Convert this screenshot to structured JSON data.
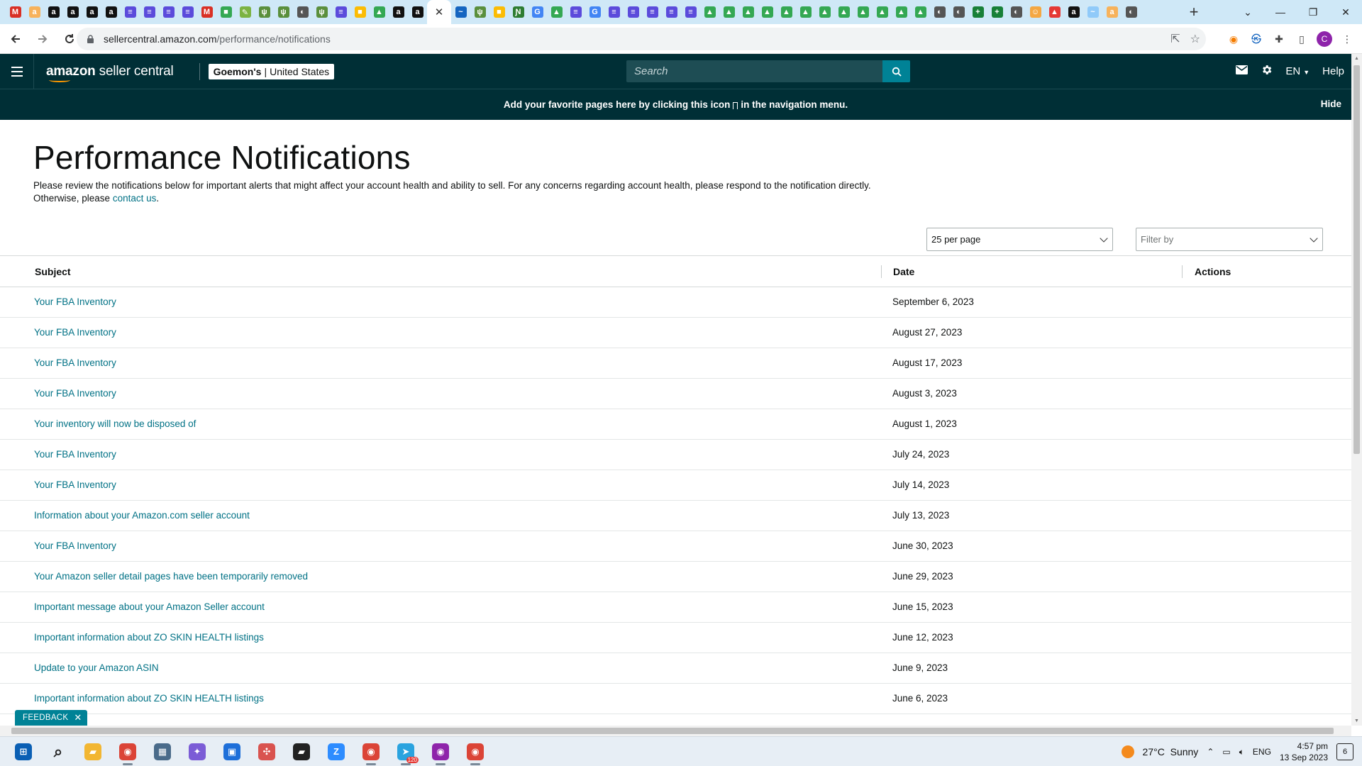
{
  "browser": {
    "tab_favicons": [
      {
        "letter": "M",
        "color": "#d93025"
      },
      {
        "letter": "a",
        "color": "#f7b25b"
      },
      {
        "letter": "a",
        "color": "#111111"
      },
      {
        "letter": "a",
        "color": "#111111"
      },
      {
        "letter": "a",
        "color": "#111111"
      },
      {
        "letter": "a",
        "color": "#111111"
      },
      {
        "letter": "≡",
        "color": "#5b4bdb"
      },
      {
        "letter": "≡",
        "color": "#5b4bdb"
      },
      {
        "letter": "≡",
        "color": "#5b4bdb"
      },
      {
        "letter": "≡",
        "color": "#5b4bdb"
      },
      {
        "letter": "M",
        "color": "#d93025"
      },
      {
        "letter": "■",
        "color": "#34a853"
      },
      {
        "letter": "✎",
        "color": "#7cb342"
      },
      {
        "letter": "ψ",
        "color": "#5a8f3c"
      },
      {
        "letter": "ψ",
        "color": "#5a8f3c"
      },
      {
        "letter": "◐",
        "color": "#555555"
      },
      {
        "letter": "ψ",
        "color": "#5a8f3c"
      },
      {
        "letter": "≡",
        "color": "#5b4bdb"
      },
      {
        "letter": "■",
        "color": "#fbbc04"
      },
      {
        "letter": "▲",
        "color": "#34a853"
      },
      {
        "letter": "a",
        "color": "#111111"
      },
      {
        "letter": "a",
        "color": "#111111"
      },
      {
        "letter": "✕",
        "color": "#ffffff"
      },
      {
        "letter": "~",
        "color": "#1565c0"
      },
      {
        "letter": "ψ",
        "color": "#5a8f3c"
      },
      {
        "letter": "■",
        "color": "#fbbc04"
      },
      {
        "letter": "Ɲ",
        "color": "#2e7d32"
      },
      {
        "letter": "G",
        "color": "#4285f4"
      },
      {
        "letter": "▲",
        "color": "#34a853"
      },
      {
        "letter": "≡",
        "color": "#5b4bdb"
      },
      {
        "letter": "G",
        "color": "#4285f4"
      },
      {
        "letter": "≡",
        "color": "#5b4bdb"
      },
      {
        "letter": "≡",
        "color": "#5b4bdb"
      },
      {
        "letter": "≡",
        "color": "#5b4bdb"
      },
      {
        "letter": "≡",
        "color": "#5b4bdb"
      },
      {
        "letter": "≡",
        "color": "#5b4bdb"
      },
      {
        "letter": "▲",
        "color": "#34a853"
      },
      {
        "letter": "▲",
        "color": "#34a853"
      },
      {
        "letter": "▲",
        "color": "#34a853"
      },
      {
        "letter": "▲",
        "color": "#34a853"
      },
      {
        "letter": "▲",
        "color": "#34a853"
      },
      {
        "letter": "▲",
        "color": "#34a853"
      },
      {
        "letter": "▲",
        "color": "#34a853"
      },
      {
        "letter": "▲",
        "color": "#34a853"
      },
      {
        "letter": "▲",
        "color": "#34a853"
      },
      {
        "letter": "▲",
        "color": "#34a853"
      },
      {
        "letter": "▲",
        "color": "#34a853"
      },
      {
        "letter": "▲",
        "color": "#34a853"
      },
      {
        "letter": "◐",
        "color": "#555555"
      },
      {
        "letter": "◐",
        "color": "#555555"
      },
      {
        "letter": "+",
        "color": "#188038"
      },
      {
        "letter": "+",
        "color": "#188038"
      },
      {
        "letter": "◐",
        "color": "#555555"
      },
      {
        "letter": "☺",
        "color": "#f4a742"
      },
      {
        "letter": "▲",
        "color": "#e53935"
      },
      {
        "letter": "a",
        "color": "#111111"
      },
      {
        "letter": "~",
        "color": "#90caf9"
      },
      {
        "letter": "a",
        "color": "#f7b25b"
      },
      {
        "letter": "◐",
        "color": "#555555"
      }
    ],
    "active_tab_index": 22,
    "url_host": "sellercentral.amazon.com",
    "url_path": "/performance/notifications",
    "profile_initial": "C"
  },
  "header": {
    "logo_bold": "amazon",
    "logo_rest": "seller central",
    "account_name": "Goemon's",
    "account_separator": "|",
    "marketplace": "United States",
    "search_placeholder": "Search",
    "language": "EN",
    "help": "Help"
  },
  "banner": {
    "text_before": "Add your favorite pages here by clicking this icon",
    "text_after": "in the navigation menu.",
    "hide": "Hide"
  },
  "page": {
    "title": "Performance Notifications",
    "description": "Please review the notifications below for important alerts that might affect your account health and ability to sell. For any concerns regarding account health, please respond to the notification directly. Otherwise, please",
    "contact_link": "contact us",
    "description_end": ".",
    "per_page": "25 per page",
    "filter_placeholder": "Filter by"
  },
  "table": {
    "columns": [
      "Subject",
      "Date",
      "Actions"
    ],
    "rows": [
      {
        "subject": "Your FBA Inventory",
        "date": "September 6, 2023"
      },
      {
        "subject": "Your FBA Inventory",
        "date": "August 27, 2023"
      },
      {
        "subject": "Your FBA Inventory",
        "date": "August 17, 2023"
      },
      {
        "subject": "Your FBA Inventory",
        "date": "August 3, 2023"
      },
      {
        "subject": "Your inventory will now be disposed of",
        "date": "August 1, 2023"
      },
      {
        "subject": "Your FBA Inventory",
        "date": "July 24, 2023"
      },
      {
        "subject": "Your FBA Inventory",
        "date": "July 14, 2023"
      },
      {
        "subject": "Information about your Amazon.com seller account",
        "date": "July 13, 2023"
      },
      {
        "subject": "Your FBA Inventory",
        "date": "June 30, 2023"
      },
      {
        "subject": "Your Amazon seller detail pages have been temporarily removed",
        "date": "June 29, 2023"
      },
      {
        "subject": "Important message about your Amazon Seller account",
        "date": "June 15, 2023"
      },
      {
        "subject": "Important information about ZO SKIN HEALTH listings",
        "date": "June 12, 2023"
      },
      {
        "subject": "Update to your Amazon ASIN",
        "date": "June 9, 2023"
      },
      {
        "subject": "Important information about ZO SKIN HEALTH listings",
        "date": "June 6, 2023"
      }
    ]
  },
  "feedback": {
    "label": "FEEDBACK",
    "close": "✕"
  },
  "taskbar": {
    "apps": [
      {
        "name": "windows-start",
        "glyph": "⊞",
        "color": "#0a5fb4"
      },
      {
        "name": "search",
        "glyph": "⌕",
        "color": "#222222"
      },
      {
        "name": "file-explorer",
        "glyph": "▰",
        "color": "#f2b632"
      },
      {
        "name": "chrome-profile-1",
        "glyph": "◉",
        "color": "#db4437"
      },
      {
        "name": "calculator",
        "glyph": "▦",
        "color": "#4a6b8a"
      },
      {
        "name": "copilot",
        "glyph": "✦",
        "color": "#7b5cd6"
      },
      {
        "name": "store",
        "glyph": "▣",
        "color": "#1e6fd9"
      },
      {
        "name": "network-app",
        "glyph": "✣",
        "color": "#d9534f"
      },
      {
        "name": "sticky-notes",
        "glyph": "▰",
        "color": "#222222"
      },
      {
        "name": "zoom",
        "glyph": "Z",
        "color": "#2d8cff"
      },
      {
        "name": "chrome-profile-2",
        "glyph": "◉",
        "color": "#db4437"
      },
      {
        "name": "telegram",
        "glyph": "➤",
        "color": "#2aa3df"
      },
      {
        "name": "chrome-profile-3",
        "glyph": "◉",
        "color": "#8e24aa"
      },
      {
        "name": "chrome-profile-4",
        "glyph": "◉",
        "color": "#db4437"
      }
    ],
    "telegram_badge": "120",
    "temperature": "27°C",
    "weather": "Sunny",
    "lang": "ENG",
    "time": "4:57 pm",
    "date": "13 Sep 2023",
    "notifications": "6"
  }
}
